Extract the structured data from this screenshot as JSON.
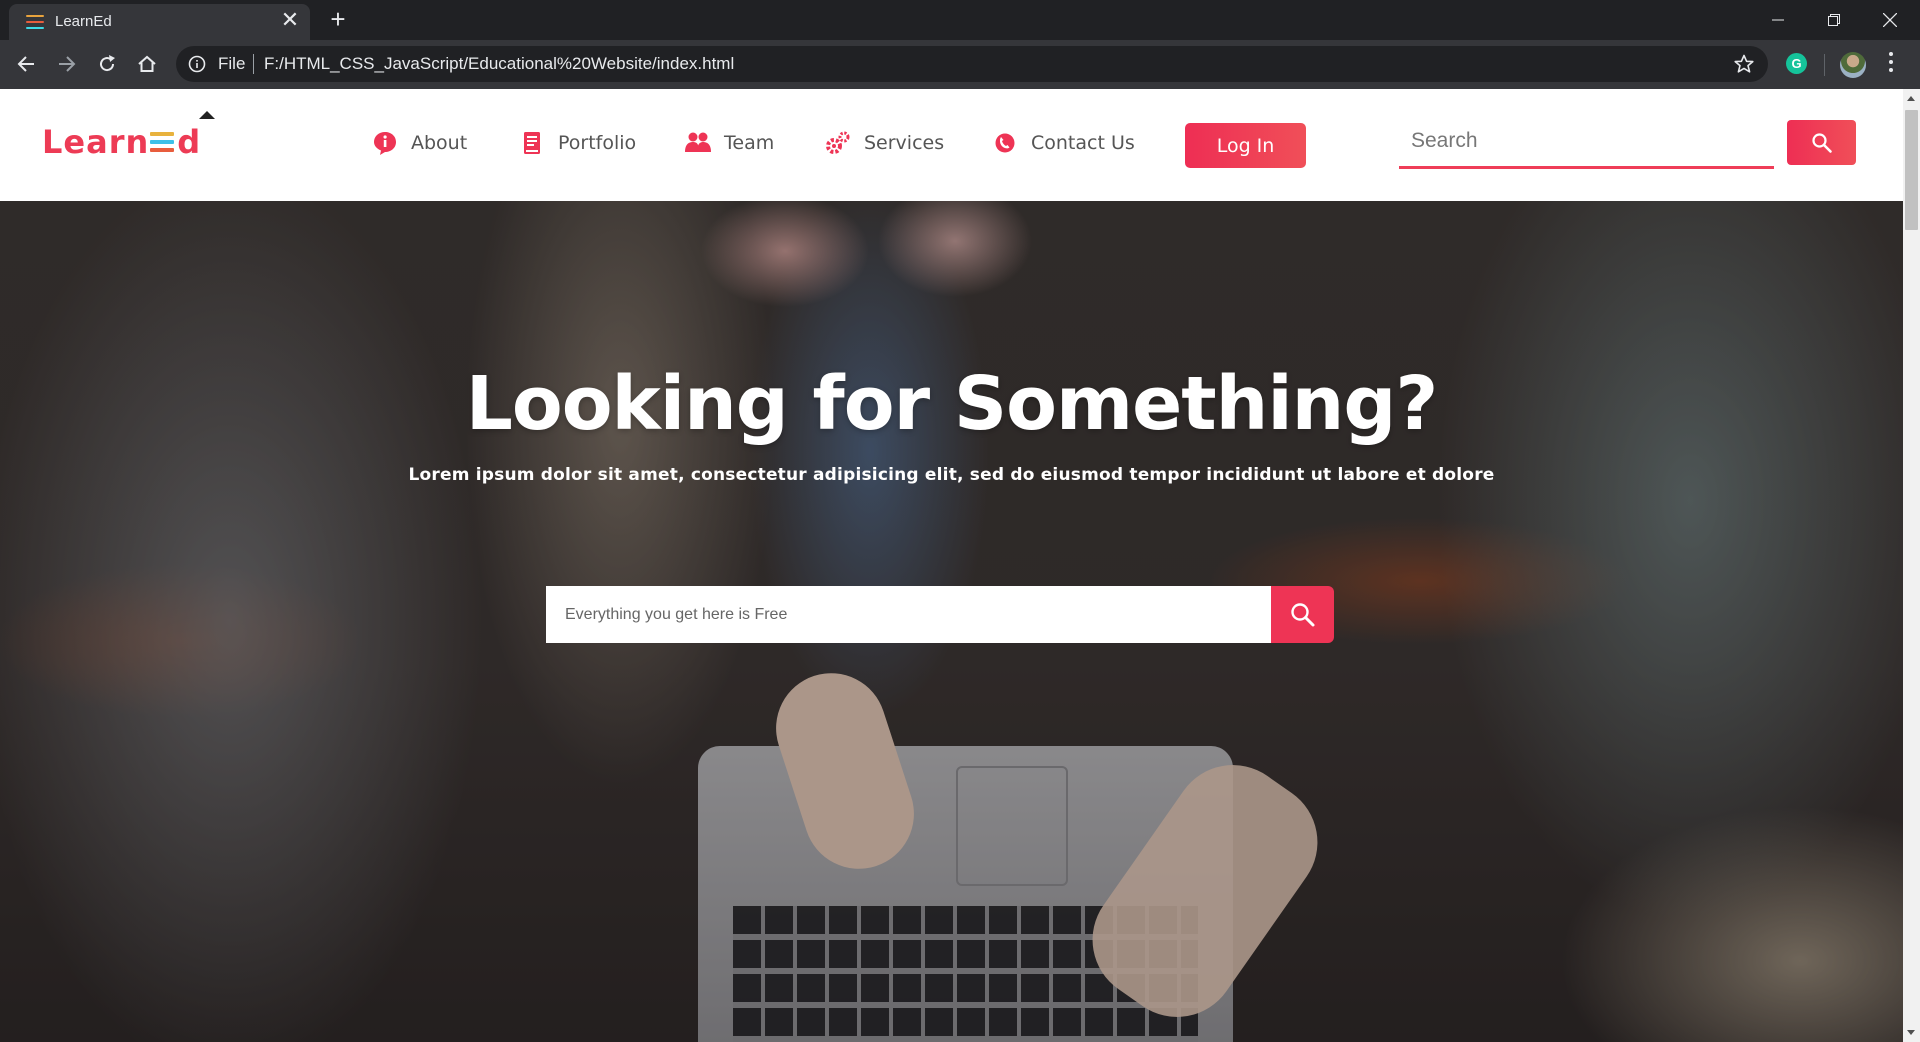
{
  "browser": {
    "tab_title": "LearnEd",
    "tab_close": "✕",
    "new_tab": "+",
    "omnibox_scheme": "File",
    "omnibox_url": "F:/HTML_CSS_JavaScript/Educational%20Website/index.html",
    "extension_letter": "G"
  },
  "site": {
    "logo": {
      "part1": "Learn",
      "part2": "d"
    },
    "nav": [
      {
        "label": "About",
        "icon": "info-icon"
      },
      {
        "label": "Portfolio",
        "icon": "book-icon"
      },
      {
        "label": "Team",
        "icon": "team-icon"
      },
      {
        "label": "Services",
        "icon": "gears-icon"
      },
      {
        "label": "Contact Us",
        "icon": "contact-icon"
      }
    ],
    "login_label": "Log In",
    "search_placeholder": "Search"
  },
  "hero": {
    "title": "Looking for Something?",
    "subtitle": "Lorem ipsum dolor sit amet, consectetur adipisicing elit, sed do eiusmod tempor incididunt ut labore et dolore",
    "search_placeholder": "Everything you get here is Free"
  },
  "colors": {
    "accent": "#ee3455",
    "chrome_dark": "#202124",
    "chrome_toolbar": "#35363a"
  }
}
